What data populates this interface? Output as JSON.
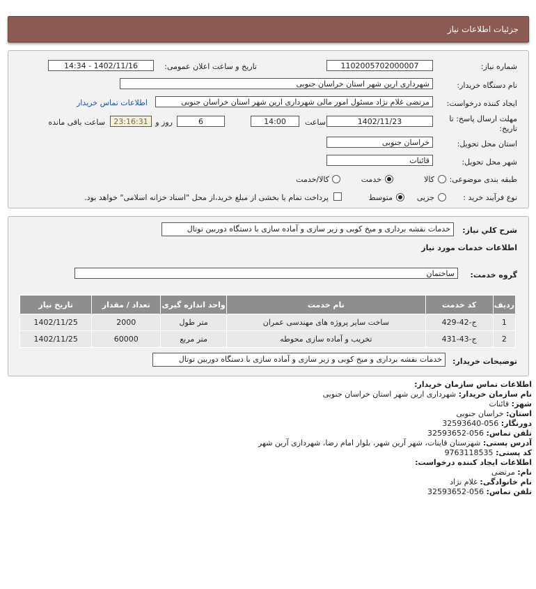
{
  "header": {
    "title": "جزئیات اطلاعات نیاز"
  },
  "info": {
    "need_number_label": "شماره نیاز:",
    "need_number": "1102005702000007",
    "announce_label": "تاریخ و ساعت اعلان عمومی:",
    "announce_value": "1402/11/16 - 14:34",
    "buyer_label": "نام دستگاه خریدار:",
    "buyer_value": "شهرداری ارین شهر استان خراسان جنوبی",
    "creator_label": "ایجاد کننده درخواست:",
    "creator_value": "مرتضی غلام نژاد مسئول امور مالی شهرداری ارین شهر استان خراسان جنوبی",
    "contact_link": "اطلاعات تماس خریدار",
    "deadline_label_1": "مهلت ارسال پاسخ: تا",
    "deadline_label_2": "تاریخ:",
    "deadline_date": "1402/11/23",
    "time_label": "ساعت",
    "deadline_time": "14:00",
    "days_value": "6",
    "days_label": "روز و",
    "remaining_time": "23:16:31",
    "remaining_label": "ساعت باقی مانده",
    "province_label": "استان محل تحویل:",
    "province_value": "خراسان جنوبی",
    "city_label": "شهر محل تحویل:",
    "city_value": "قائنات",
    "category_label": "طبقه بندی موضوعی:",
    "category_options": [
      "کالا",
      "خدمت",
      "کالا/خدمت"
    ],
    "purchase_label": "نوع فرآیند خرید :",
    "purchase_options": [
      "جزیی",
      "متوسط"
    ],
    "payment_text": "پرداخت تمام یا بخشی از مبلغ خرید،از محل \"اسناد خزانه اسلامی\" خواهد بود."
  },
  "details": {
    "desc_label": "شرح کلي نياز:",
    "desc_value": "خدمات نقشه برداری و میخ کوبی و زیر سازی و آماده سازی با دستگاه دوربین توتال",
    "services_title": "اطلاعات خدمات مورد نیاز",
    "group_label": "گروه خدمت:",
    "group_value": "ساختمان",
    "table_headers": [
      "ردیف",
      "کد خدمت",
      "نام خدمت",
      "واحد اندازه گیری",
      "تعداد / مقدار",
      "تاریخ نیاز"
    ],
    "rows": [
      [
        "1",
        "ج-42-429",
        "ساخت سایر پروژه های مهندسی عمران",
        "متر طول",
        "2000",
        "1402/11/25"
      ],
      [
        "2",
        "ج-43-431",
        "تخریب و آماده سازی محوطه",
        "متر مربع",
        "60000",
        "1402/11/25"
      ]
    ],
    "buyer_desc_label": "توضیحات خریدار:",
    "buyer_desc_value": "خدمات نقشه برداری و میخ کوبی و زیر سازی و آماده سازی با دستگاه دوربین توتال"
  },
  "contact": {
    "org_title": "اطلاعات تماس سازمان خریدار:",
    "org_name_label": "نام سازمان خریدار:",
    "org_name": "شهرداری ارین شهر استان خراسان جنوبی",
    "city_label": "شهر:",
    "city": "قائنات",
    "province_label": "استان:",
    "province": "خراسان جنوبی",
    "fax_label": "دورنگار:",
    "fax": "056-32593640",
    "phone_label": "تلفن تماس:",
    "phone": "056-32593652",
    "address_label": "آدرس پستی:",
    "address": "شهرستان قاینات، شهر آرین شهر، بلوار امام رضا، شهرداری آرین شهر",
    "postal_label": "کد پستی:",
    "postal": "9763118535",
    "creator_title": "اطلاعات ایجاد کننده درخواست:",
    "first_name_label": "نام:",
    "first_name": "مرتضی",
    "last_name_label": "نام خانوادگی:",
    "last_name": "غلام نژاد",
    "creator_phone_label": "تلفن تماس:",
    "creator_phone": "056-32593652"
  }
}
